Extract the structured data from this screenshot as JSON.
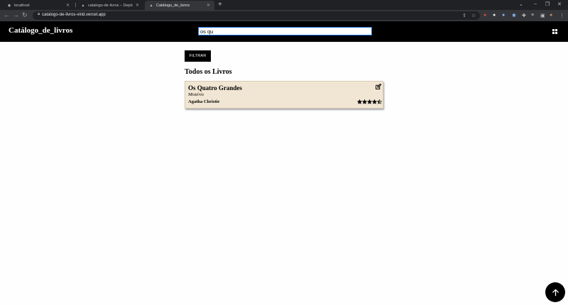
{
  "browser": {
    "tabs": [
      {
        "label": "localhost",
        "active": false
      },
      {
        "label": "catalogo-de-livros – Deployment",
        "active": false
      },
      {
        "label": "Catálogo_de_livros",
        "active": true
      }
    ],
    "url": "catalogo-de-livros-virid.vercel.app"
  },
  "header": {
    "brand": "Catálogo_de_livros",
    "search_value": "os qu"
  },
  "filter": {
    "button_label": "FILTRAR"
  },
  "section": {
    "title": "Todos os Livros"
  },
  "books": [
    {
      "title": "Os Quatro Grandes",
      "genre": "Mistério",
      "author": "Agatha Christie",
      "rating": 4.5,
      "max_rating": 5
    }
  ]
}
